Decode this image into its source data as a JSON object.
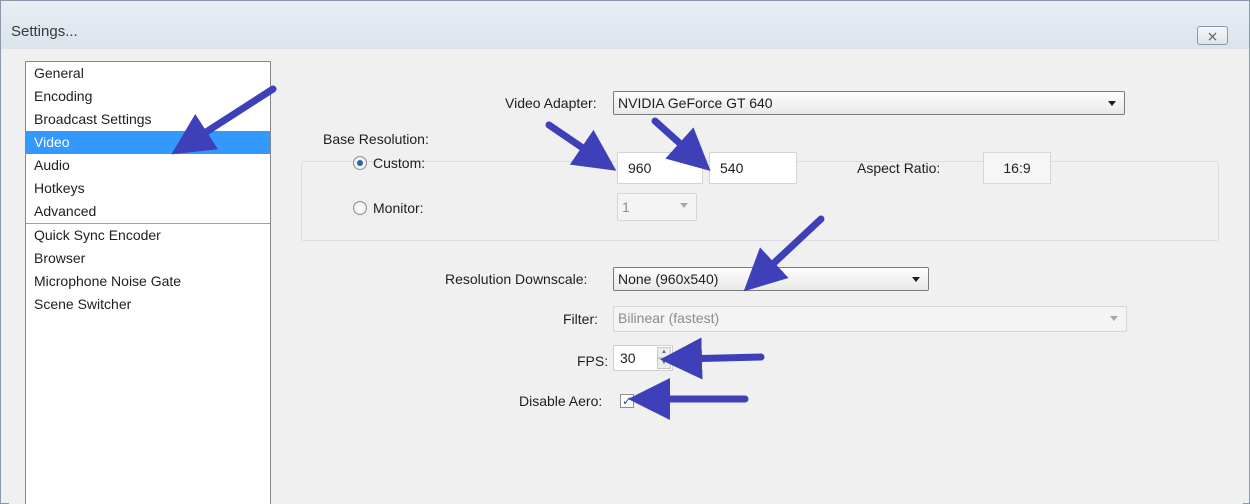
{
  "window": {
    "title": "Settings...",
    "close_glyph": "⨯"
  },
  "sidebar": {
    "items": [
      {
        "label": "General",
        "selected": false
      },
      {
        "label": "Encoding",
        "selected": false
      },
      {
        "label": "Broadcast Settings",
        "selected": false
      },
      {
        "label": "Video",
        "selected": true
      },
      {
        "label": "Audio",
        "selected": false
      },
      {
        "label": "Hotkeys",
        "selected": false
      },
      {
        "label": "Advanced",
        "selected": false
      },
      {
        "label": "Quick Sync Encoder",
        "selected": false
      },
      {
        "label": "Browser",
        "selected": false
      },
      {
        "label": "Microphone Noise Gate",
        "selected": false
      },
      {
        "label": "Scene Switcher",
        "selected": false
      }
    ]
  },
  "video": {
    "adapter_label": "Video Adapter:",
    "adapter_value": "NVIDIA GeForce GT 640",
    "base_resolution_label": "Base Resolution:",
    "custom_label": "Custom:",
    "custom_selected": true,
    "width_value": "960",
    "height_value": "540",
    "aspect_label": "Aspect Ratio:",
    "aspect_value": "16:9",
    "monitor_label": "Monitor:",
    "monitor_selected": false,
    "monitor_value": "1",
    "downscale_label": "Resolution Downscale:",
    "downscale_value": "None  (960x540)",
    "filter_label": "Filter:",
    "filter_value": "Bilinear (fastest)",
    "fps_label": "FPS:",
    "fps_value": "30",
    "disable_aero_label": "Disable Aero:",
    "disable_aero_checked": true,
    "check_glyph": "✓"
  },
  "colors": {
    "selection": "#3399ff",
    "annotation_arrow": "#3d40b8"
  },
  "annotation": {
    "arrow_icon": "pointer-arrow-icon"
  }
}
